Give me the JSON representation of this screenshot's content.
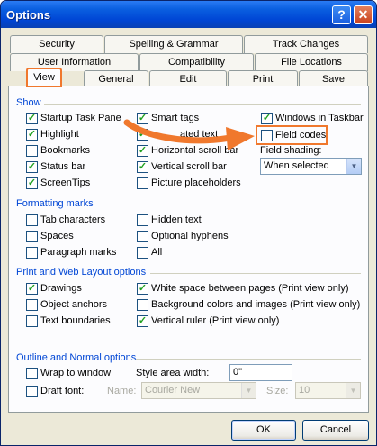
{
  "window": {
    "title": "Options"
  },
  "titlebar": {
    "help_glyph": "?",
    "close_glyph": "✕"
  },
  "tabs": {
    "row1": [
      "Security",
      "Spelling & Grammar",
      "Track Changes"
    ],
    "row2": [
      "User Information",
      "Compatibility",
      "File Locations"
    ],
    "row3": [
      "View",
      "General",
      "Edit",
      "Print",
      "Save"
    ]
  },
  "show": {
    "heading": "Show",
    "items": [
      {
        "label": "Startup Task Pane",
        "checked": true
      },
      {
        "label": "Highlight",
        "checked": true
      },
      {
        "label": "Bookmarks",
        "checked": false
      },
      {
        "label": "Status bar",
        "checked": true
      },
      {
        "label": "ScreenTips",
        "checked": true
      },
      {
        "label": "Smart tags",
        "checked": true
      },
      {
        "label": "Animated text",
        "checked": true
      },
      {
        "label": "Horizontal scroll bar",
        "checked": true
      },
      {
        "label": "Vertical scroll bar",
        "checked": true
      },
      {
        "label": "Picture placeholders",
        "checked": false
      },
      {
        "label": "Windows in Taskbar",
        "checked": true
      },
      {
        "label": "Field codes",
        "checked": false
      }
    ],
    "visible_labels": [
      "Startup Task Pane",
      "Highlight",
      "Bookmarks",
      "Status bar",
      "ScreenTips",
      "Smart tags",
      "ated text",
      "Horizontal scroll bar",
      "Vertical scroll bar",
      "Picture placeholders",
      "Windows in Taskbar",
      "Field codes"
    ],
    "field_shading_label": "Field shading:",
    "field_shading_value": "When selected"
  },
  "formatting": {
    "heading": "Formatting marks",
    "items": [
      {
        "label": "Tab characters",
        "checked": false
      },
      {
        "label": "Spaces",
        "checked": false
      },
      {
        "label": "Paragraph marks",
        "checked": false
      },
      {
        "label": "Hidden text",
        "checked": false
      },
      {
        "label": "Optional hyphens",
        "checked": false
      },
      {
        "label": "All",
        "checked": false
      }
    ]
  },
  "print_layout": {
    "heading": "Print and Web Layout options",
    "items": [
      {
        "label": "Drawings",
        "checked": true
      },
      {
        "label": "Object anchors",
        "checked": false
      },
      {
        "label": "Text boundaries",
        "checked": false
      },
      {
        "label": "White space between pages (Print view only)",
        "checked": true
      },
      {
        "label": "Background colors and images (Print view only)",
        "checked": false
      },
      {
        "label": "Vertical ruler (Print view only)",
        "checked": true
      }
    ]
  },
  "outline": {
    "heading": "Outline and Normal options",
    "wrap_label": "Wrap to window",
    "wrap_checked": false,
    "draft_label": "Draft font:",
    "draft_checked": false,
    "style_area_label": "Style area width:",
    "style_area_value": "0\"",
    "name_label": "Name:",
    "name_value": "Courier New",
    "size_label": "Size:",
    "size_value": "10"
  },
  "buttons": {
    "ok": "OK",
    "cancel": "Cancel"
  },
  "colors": {
    "accent": "#0046d5",
    "highlight": "#f0782d",
    "check": "#21a121"
  },
  "icons": {
    "dropdown": "▼",
    "check": "✓"
  }
}
